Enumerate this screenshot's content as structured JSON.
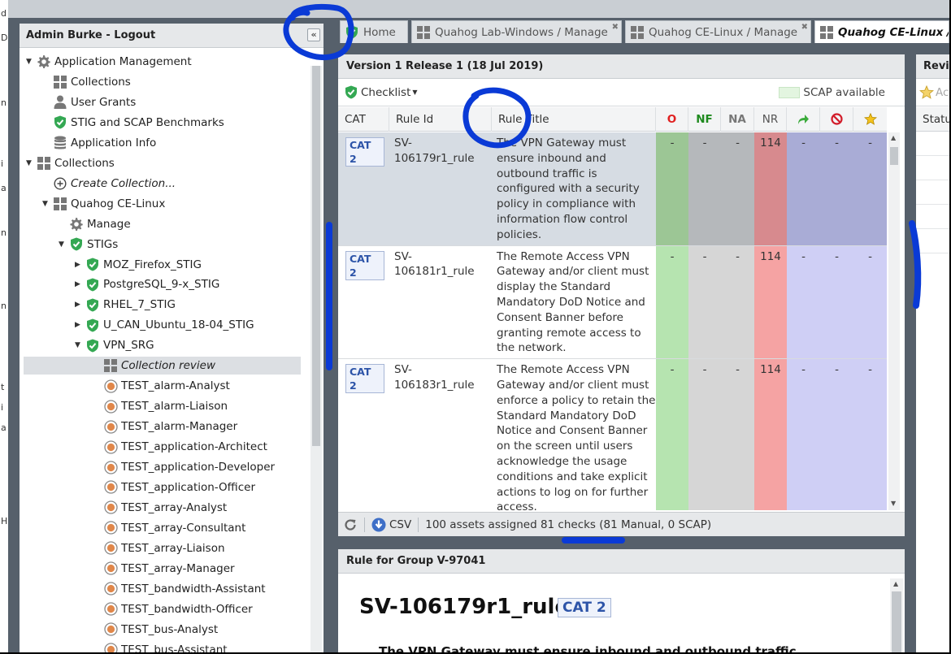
{
  "nav": {
    "header": "Admin Burke - Logout",
    "tree": [
      {
        "label": "Application Management",
        "icon": "gear-icon",
        "toggle": "open",
        "level": 0
      },
      {
        "label": "Collections",
        "icon": "grid-icon",
        "level": 1
      },
      {
        "label": "User Grants",
        "icon": "user-icon",
        "level": 1
      },
      {
        "label": "STIG and SCAP Benchmarks",
        "icon": "shield-check-icon",
        "level": 1
      },
      {
        "label": "Application Info",
        "icon": "database-icon",
        "level": 1
      },
      {
        "label": "Collections",
        "icon": "grid-icon",
        "toggle": "open",
        "level": 0
      },
      {
        "label": "Create Collection...",
        "icon": "plus-circle-icon",
        "level": 1,
        "italic": true
      },
      {
        "label": "Quahog CE-Linux",
        "icon": "grid-icon",
        "toggle": "open",
        "level": 1
      },
      {
        "label": "Manage",
        "icon": "gear-icon",
        "level": 2
      },
      {
        "label": "STIGs",
        "icon": "shield-check-icon",
        "toggle": "open",
        "level": 2
      },
      {
        "label": "MOZ_Firefox_STIG",
        "icon": "shield-check-icon",
        "toggle": "closed",
        "level": 3
      },
      {
        "label": "PostgreSQL_9-x_STIG",
        "icon": "shield-check-icon",
        "toggle": "closed",
        "level": 3
      },
      {
        "label": "RHEL_7_STIG",
        "icon": "shield-check-icon",
        "toggle": "closed",
        "level": 3
      },
      {
        "label": "U_CAN_Ubuntu_18-04_STIG",
        "icon": "shield-check-icon",
        "toggle": "closed",
        "level": 3
      },
      {
        "label": "VPN_SRG",
        "icon": "shield-check-icon",
        "toggle": "open",
        "level": 3
      },
      {
        "label": "Collection review",
        "icon": "grid-icon",
        "level": 4,
        "italic": true,
        "selected": true
      },
      {
        "label": "TEST_alarm-Analyst",
        "icon": "asset-icon",
        "level": 4
      },
      {
        "label": "TEST_alarm-Liaison",
        "icon": "asset-icon",
        "level": 4
      },
      {
        "label": "TEST_alarm-Manager",
        "icon": "asset-icon",
        "level": 4
      },
      {
        "label": "TEST_application-Architect",
        "icon": "asset-icon",
        "level": 4
      },
      {
        "label": "TEST_application-Developer",
        "icon": "asset-icon",
        "level": 4
      },
      {
        "label": "TEST_application-Officer",
        "icon": "asset-icon",
        "level": 4
      },
      {
        "label": "TEST_array-Analyst",
        "icon": "asset-icon",
        "level": 4
      },
      {
        "label": "TEST_array-Consultant",
        "icon": "asset-icon",
        "level": 4
      },
      {
        "label": "TEST_array-Liaison",
        "icon": "asset-icon",
        "level": 4
      },
      {
        "label": "TEST_array-Manager",
        "icon": "asset-icon",
        "level": 4
      },
      {
        "label": "TEST_bandwidth-Assistant",
        "icon": "asset-icon",
        "level": 4
      },
      {
        "label": "TEST_bandwidth-Officer",
        "icon": "asset-icon",
        "level": 4
      },
      {
        "label": "TEST_bus-Analyst",
        "icon": "asset-icon",
        "level": 4
      },
      {
        "label": "TEST_bus-Assistant",
        "icon": "asset-icon",
        "level": 4
      }
    ]
  },
  "tabs": [
    {
      "label": "Home",
      "icon": "shield-check-icon"
    },
    {
      "label": "Quahog Lab-Windows / Manage",
      "icon": "grid-icon",
      "close": "✖"
    },
    {
      "label": "Quahog CE-Linux / Manage",
      "icon": "grid-icon",
      "close": "✖"
    },
    {
      "label": "Quahog CE-Linux / VP",
      "icon": "grid-icon",
      "active": true
    }
  ],
  "checklist": {
    "title": "Version 1 Release 1 (18 Jul 2019)",
    "menu_label": "Checklist",
    "scap_legend": "SCAP available",
    "columns": {
      "cat": "CAT",
      "rule_id": "Rule Id",
      "rule_title": "Rule Title",
      "o": "O",
      "nf": "NF",
      "na": "NA",
      "nr": "NR"
    },
    "rows": [
      {
        "cat": "CAT 2",
        "rule_id": "SV-106179r1_rule",
        "title_lines": [
          "The VPN Gateway must",
          "ensure inbound and",
          "outbound traffic is",
          "configured with a security",
          "policy in compliance with",
          "information flow control",
          "policies."
        ],
        "o": "-",
        "nf": "-",
        "na": "-",
        "nr": "114",
        "accepted": "-",
        "rejected": "-",
        "starred": "-",
        "selected": true
      },
      {
        "cat": "CAT 2",
        "rule_id": "SV-106181r1_rule",
        "title_lines": [
          "The Remote Access VPN",
          "Gateway and/or client must",
          "display the Standard",
          "Mandatory DoD Notice and",
          "Consent Banner before",
          "granting remote access to",
          "the network."
        ],
        "o": "-",
        "nf": "-",
        "na": "-",
        "nr": "114",
        "accepted": "-",
        "rejected": "-",
        "starred": "-"
      },
      {
        "cat": "CAT 2",
        "rule_id": "SV-106183r1_rule",
        "title_lines": [
          "The Remote Access VPN",
          "Gateway and/or client must",
          "enforce a policy to retain the",
          "Standard Mandatory DoD",
          "Notice and Consent Banner",
          "on the screen until users",
          "acknowledge the usage",
          "conditions and take explicit",
          "actions to log on for further",
          "access."
        ],
        "o": "-",
        "nf": "-",
        "na": "-",
        "nr": "114",
        "accepted": "-",
        "rejected": "-",
        "starred": "-"
      }
    ],
    "footer": {
      "csv_label": "CSV",
      "summary": "100 assets assigned 81 checks (81 Manual, 0 SCAP)"
    }
  },
  "rule_panel": {
    "title": "Rule for Group V-97041",
    "rule_id": "SV-106179r1_rule",
    "cat": "CAT 2",
    "text_start": "The VPN Gateway must ensure inbound and outbound traffic"
  },
  "review_panel": {
    "title": "Revi",
    "add_label": "Ac",
    "status_col": "Statu"
  },
  "left_edge_fragments": [
    "d",
    "D",
    "n",
    "i",
    "a",
    "n",
    "n",
    "t",
    "i",
    "a",
    "H"
  ],
  "colors": {
    "o_col": "#b6e4b0",
    "nf_col": "#d6d6d6",
    "na_col": "#d6d6d6",
    "nr_col": "#f5a3a3",
    "status_col": "#cfcff5",
    "o_col_sel": "#9cc695",
    "nf_col_sel": "#b5b8bb",
    "nr_col_sel": "#d78a8e",
    "status_col_sel": "#a9acd6",
    "annotation": "#0a3ad6"
  }
}
